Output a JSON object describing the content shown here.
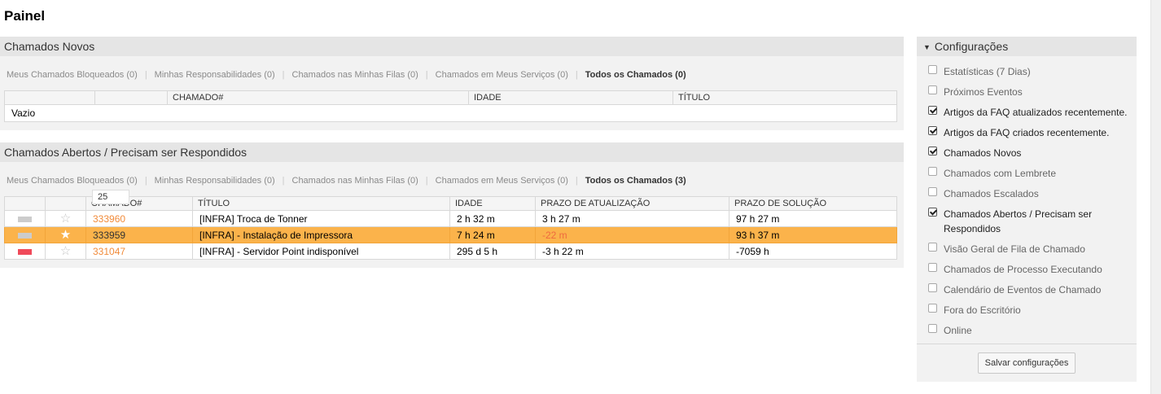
{
  "page_title": "Painel",
  "tabs": [
    "Meus Chamados Bloqueados (0)",
    "Minhas Responsabilidades (0)",
    "Chamados nas Minhas Filas (0)",
    "Chamados em Meus Serviços (0)"
  ],
  "new_tickets": {
    "title": "Chamados Novos",
    "active_tab": "Todos os Chamados (0)",
    "columns": [
      "",
      "",
      "CHAMADO#",
      "IDADE",
      "TÍTULO"
    ],
    "empty_text": "Vazio"
  },
  "open_tickets": {
    "title": "Chamados Abertos / Precisam ser Respondidos",
    "active_tab": "Todos os Chamados (3)",
    "page_size": "25",
    "columns": [
      "",
      "",
      "CHAMADO#",
      "TÍTULO",
      "IDADE",
      "PRAZO DE ATUALIZAÇÃO",
      "PRAZO DE SOLUÇÃO"
    ],
    "rows": [
      {
        "priority_color": "#cccccc",
        "star": "☆",
        "ticket": "333960",
        "title": "[INFRA] Troca de Tonner",
        "age": "2 h 32 m",
        "update_due": "3 h 27 m",
        "solution_due": "97 h 27 m"
      },
      {
        "priority_color": "#cccccc",
        "star": "★",
        "ticket": "333959",
        "title": "[INFRA] - Instalação de Impressora",
        "age": "7 h 24 m",
        "update_due": "-22 m",
        "solution_due": "93 h 37 m"
      },
      {
        "priority_color": "#f04a5a",
        "star": "☆",
        "ticket": "331047",
        "title": "[INFRA] - Servidor Point indisponível",
        "age": "295 d 5 h",
        "update_due": "-3 h 22 m",
        "solution_due": "-7059 h"
      }
    ]
  },
  "config": {
    "title": "Configurações",
    "items": [
      {
        "label": "Estatísticas (7 Dias)",
        "checked": false
      },
      {
        "label": "Próximos Eventos",
        "checked": false
      },
      {
        "label": "Artigos da FAQ atualizados recentemente.",
        "checked": true
      },
      {
        "label": "Artigos da FAQ criados recentemente.",
        "checked": true
      },
      {
        "label": "Chamados Novos",
        "checked": true
      },
      {
        "label": "Chamados com Lembrete",
        "checked": false
      },
      {
        "label": "Chamados Escalados",
        "checked": false
      },
      {
        "label": "Chamados Abertos / Precisam ser Respondidos",
        "checked": true
      },
      {
        "label": "Visão Geral de Fila de Chamado",
        "checked": false
      },
      {
        "label": "Chamados de Processo Executando",
        "checked": false
      },
      {
        "label": "Calendário de Eventos de Chamado",
        "checked": false
      },
      {
        "label": "Fora do Escritório",
        "checked": false
      },
      {
        "label": "Online",
        "checked": false
      }
    ],
    "save_label": "Salvar configurações"
  }
}
